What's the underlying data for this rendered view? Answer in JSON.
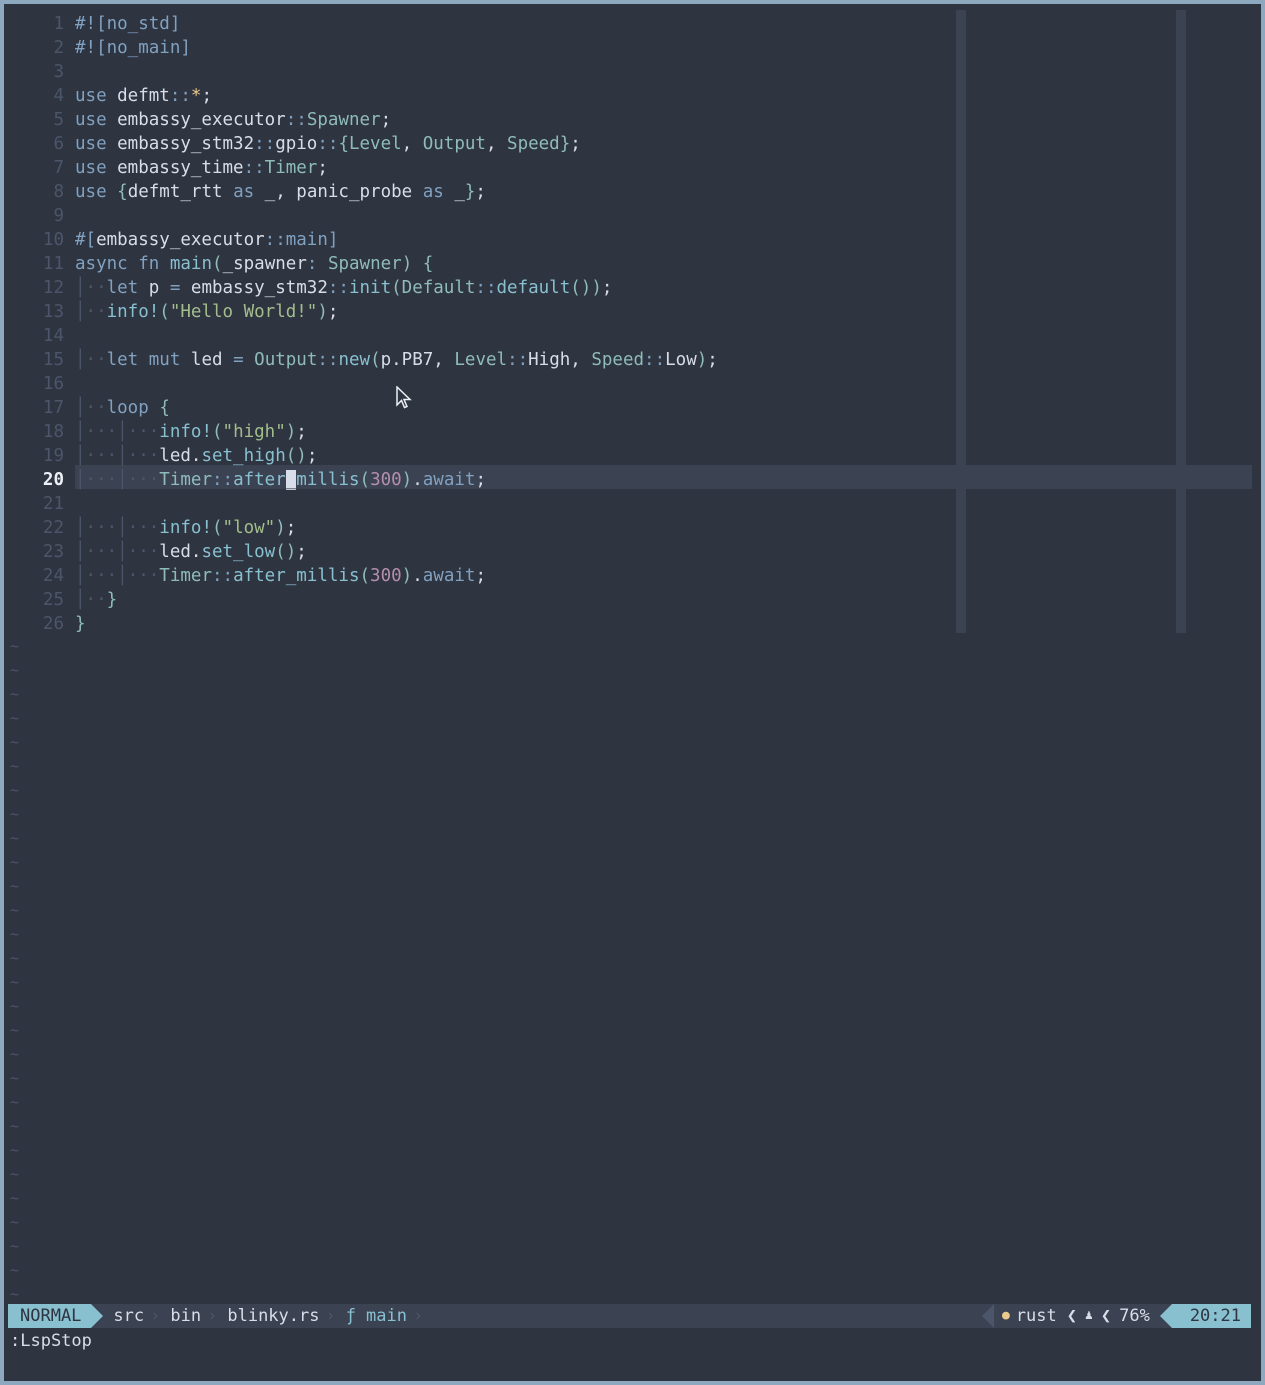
{
  "editor": {
    "code_lines": [
      {
        "n": "1",
        "t": "#![no_std]"
      },
      {
        "n": "2",
        "t": "#![no_main]"
      },
      {
        "n": "3",
        "t": ""
      },
      {
        "n": "4",
        "t": "use defmt::*;"
      },
      {
        "n": "5",
        "t": "use embassy_executor::Spawner;"
      },
      {
        "n": "6",
        "t": "use embassy_stm32::gpio::{Level, Output, Speed};"
      },
      {
        "n": "7",
        "t": "use embassy_time::Timer;"
      },
      {
        "n": "8",
        "t": "use {defmt_rtt as _, panic_probe as _};"
      },
      {
        "n": "9",
        "t": ""
      },
      {
        "n": "10",
        "t": "#[embassy_executor::main]"
      },
      {
        "n": "11",
        "t": "async fn main(_spawner: Spawner) {"
      },
      {
        "n": "12",
        "t": "let p = embassy_stm32::init(Default::default());"
      },
      {
        "n": "13",
        "t": "info!(\"Hello World!\");"
      },
      {
        "n": "14",
        "t": ""
      },
      {
        "n": "15",
        "t": "let mut led = Output::new(p.PB7, Level::High, Speed::Low);"
      },
      {
        "n": "16",
        "t": ""
      },
      {
        "n": "17",
        "t": "loop {"
      },
      {
        "n": "18",
        "t": "info!(\"high\");"
      },
      {
        "n": "19",
        "t": "led.set_high();"
      },
      {
        "n": "20",
        "t": "Timer::after_millis(300).await;"
      },
      {
        "n": "21",
        "t": ""
      },
      {
        "n": "22",
        "t": "info!(\"low\");"
      },
      {
        "n": "23",
        "t": "led.set_low();"
      },
      {
        "n": "24",
        "t": "Timer::after_millis(300).await;"
      },
      {
        "n": "25",
        "t": "}"
      },
      {
        "n": "26",
        "t": "}"
      }
    ],
    "current_line": "20",
    "tilde": "~"
  },
  "statusline": {
    "mode": "NORMAL",
    "breadcrumbs": [
      "src",
      "bin",
      "blinky.rs"
    ],
    "function_icon": "function-icon",
    "function_glyph": "ƒ",
    "function_name": "main",
    "filetype_icon": "rust-icon",
    "filetype": "rust",
    "lsp_icon": "person-icon",
    "percent": "76%",
    "position": "20:21"
  },
  "cmdline": ":LspStop",
  "colors": {
    "bg": "#2e3440",
    "accent": "#88c0d0",
    "keyword": "#81a1c1",
    "string": "#a3be8c",
    "number": "#b48ead"
  }
}
